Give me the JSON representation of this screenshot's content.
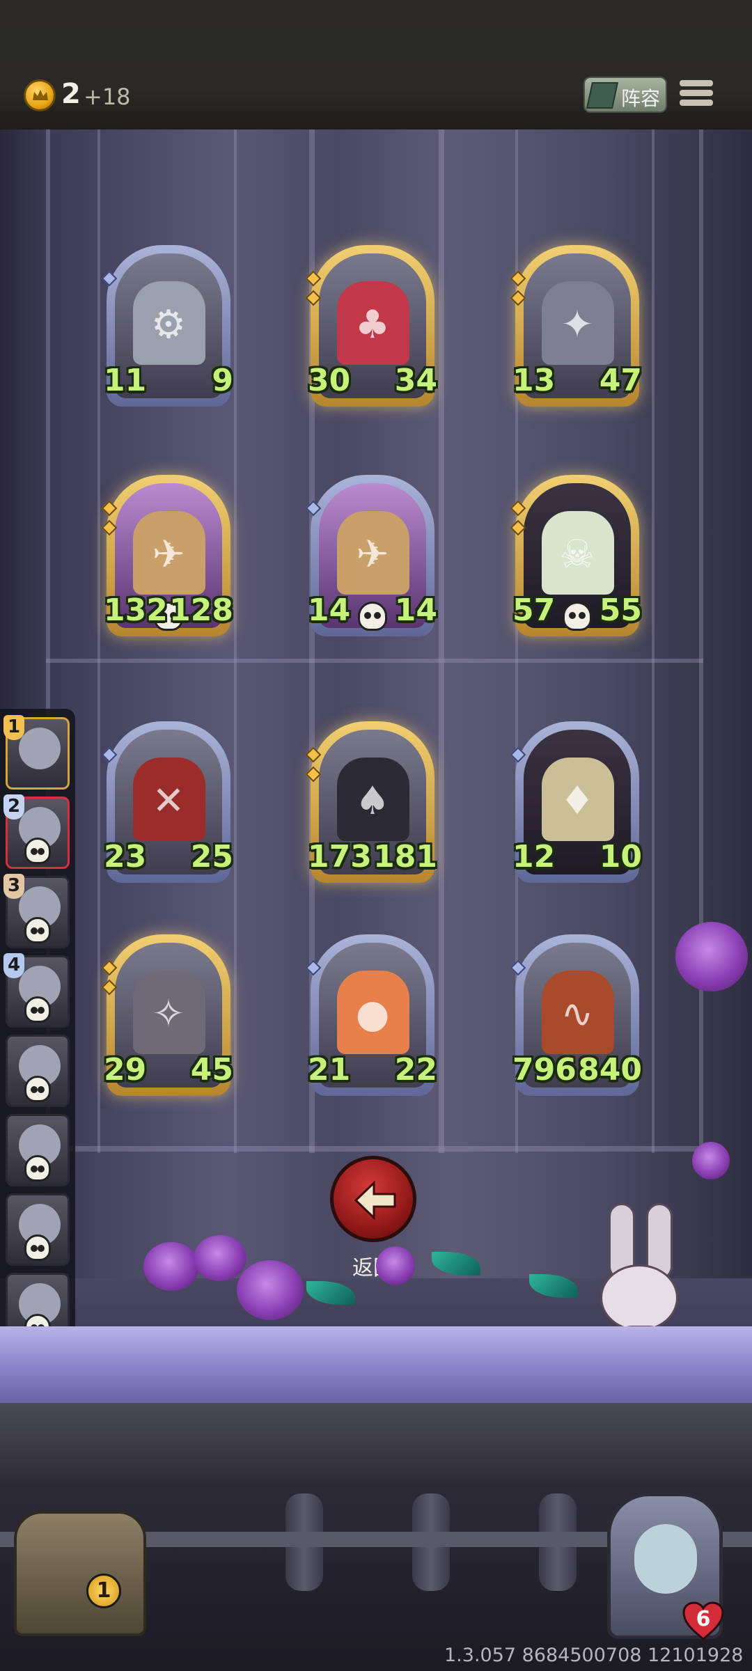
{
  "hud": {
    "gold": "2",
    "gold_income": "+18",
    "lineup_label": "阵容"
  },
  "board": {
    "rows": [
      [
        {
          "atk": "11",
          "hp": "9",
          "frame": "silver",
          "subject": "robot"
        },
        {
          "atk": "30",
          "hp": "34",
          "frame": "gold",
          "subject": "jester"
        },
        {
          "atk": "13",
          "hp": "47",
          "frame": "gold",
          "subject": "rat"
        }
      ],
      [
        {
          "atk": "132",
          "hp": "128",
          "frame": "gold",
          "subject": "airship",
          "dead": true
        },
        {
          "atk": "14",
          "hp": "14",
          "frame": "silver",
          "subject": "airship",
          "dead": true
        },
        {
          "atk": "57",
          "hp": "55",
          "frame": "gold",
          "subject": "skull-demon",
          "dead": true
        }
      ],
      [
        {
          "atk": "23",
          "hp": "25",
          "frame": "silver",
          "subject": "assassin"
        },
        {
          "atk": "173",
          "hp": "181",
          "frame": "gold",
          "subject": "magician"
        },
        {
          "atk": "12",
          "hp": "10",
          "frame": "silver",
          "subject": "knight"
        }
      ],
      [
        {
          "atk": "29",
          "hp": "45",
          "frame": "gold",
          "subject": "dragon"
        },
        {
          "atk": "21",
          "hp": "22",
          "frame": "silver",
          "subject": "clown"
        },
        {
          "atk": "796",
          "hp": "840",
          "frame": "silver",
          "subject": "serpent"
        }
      ]
    ]
  },
  "sidebar": {
    "slots": [
      {
        "label": "1",
        "state": "active"
      },
      {
        "label": "2",
        "state": "selected"
      },
      {
        "label": "3",
        "state": "eliminated"
      },
      {
        "label": "4",
        "state": "eliminated"
      },
      {
        "label": "",
        "state": "eliminated"
      },
      {
        "label": "",
        "state": "eliminated"
      },
      {
        "label": "",
        "state": "eliminated"
      },
      {
        "label": "",
        "state": "eliminated"
      }
    ]
  },
  "back_button": {
    "label": "返回",
    "icon": "arrow-left-icon"
  },
  "chest": {
    "count": "1"
  },
  "player": {
    "health": "6"
  },
  "version": "1.3.057 8684500708 12101928",
  "colors": {
    "stat": "#c6f27a",
    "gold_frame": "#d9ac4f",
    "silver_frame": "#8f97c0",
    "back_button": "#b52626"
  }
}
